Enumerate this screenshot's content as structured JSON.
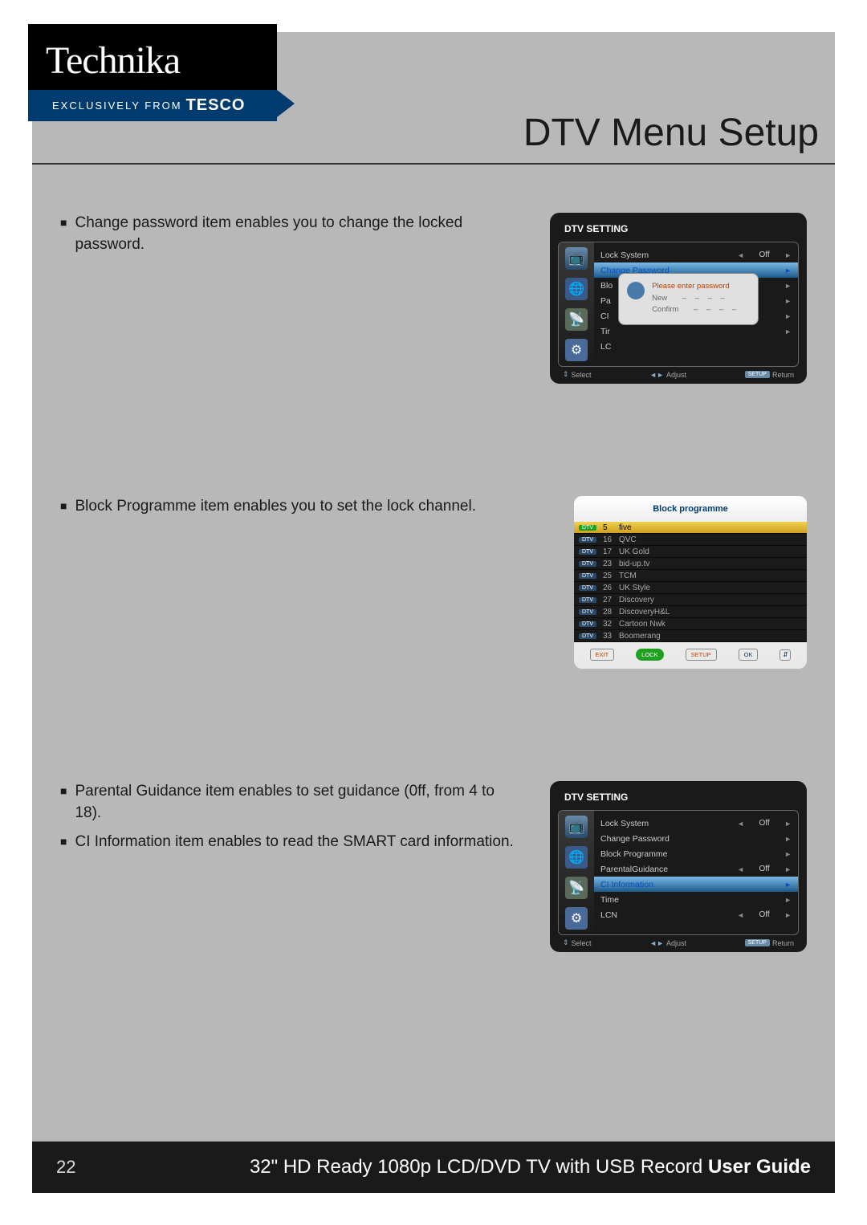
{
  "brand": {
    "name": "Technika",
    "exclusive_prefix": "EXCLUSIVELY FROM",
    "exclusive_brand": "TESCO"
  },
  "page_title": "DTV Menu Setup",
  "sections": [
    {
      "bullets": [
        "Change password item enables you to change the locked password."
      ]
    },
    {
      "bullets": [
        "Block Programme item enables you to set the lock channel."
      ]
    },
    {
      "bullets": [
        "Parental Guidance item enables to set guidance (0ff, from 4 to 18).",
        "CI Information item enables to read the SMART card information."
      ]
    }
  ],
  "osd1": {
    "title": "DTV SETTING",
    "highlighted": "Change Password",
    "rows": [
      {
        "label": "Lock System",
        "value": "Off",
        "arrows": true
      },
      {
        "label": "Change Password",
        "highlighted": true
      },
      {
        "label": "Blo"
      },
      {
        "label": "Pa"
      },
      {
        "label": "CI"
      },
      {
        "label": "Tir"
      },
      {
        "label": "LC"
      }
    ],
    "popup": {
      "prompt": "Please enter password",
      "new_label": "New",
      "confirm_label": "Confirm",
      "dashes": "– – – –"
    },
    "footer": {
      "select": "Select",
      "adjust": "Adjust",
      "return": "Return",
      "setup": "SETUP"
    }
  },
  "osd2": {
    "title": "Block programme",
    "channels": [
      {
        "num": "5",
        "name": "five",
        "selected": true
      },
      {
        "num": "16",
        "name": "QVC"
      },
      {
        "num": "17",
        "name": "UK Gold"
      },
      {
        "num": "23",
        "name": "bid-up.tv"
      },
      {
        "num": "25",
        "name": "TCM"
      },
      {
        "num": "26",
        "name": "UK Style"
      },
      {
        "num": "27",
        "name": "Discovery"
      },
      {
        "num": "28",
        "name": "DiscoveryH&L"
      },
      {
        "num": "32",
        "name": "Cartoon Nwk"
      },
      {
        "num": "33",
        "name": "Boomerang"
      }
    ],
    "dtv_label": "DTV",
    "footer": {
      "exit": "EXIT",
      "lock": "LOCK",
      "setup": "SETUP",
      "ok": "OK"
    }
  },
  "osd3": {
    "title": "DTV SETTING",
    "rows": [
      {
        "label": "Lock System",
        "value": "Off",
        "arrows": true
      },
      {
        "label": "Change Password",
        "arrow_right": true
      },
      {
        "label": "Block Programme",
        "arrow_right": true
      },
      {
        "label": "ParentalGuidance",
        "value": "Off",
        "arrows": true
      },
      {
        "label": "CI Information",
        "highlighted": true,
        "arrow_right": true
      },
      {
        "label": "Time",
        "arrow_right": true
      },
      {
        "label": "LCN",
        "value": "Off",
        "arrows": true
      }
    ],
    "footer": {
      "select": "Select",
      "adjust": "Adjust",
      "return": "Return",
      "setup": "SETUP"
    }
  },
  "footer": {
    "page_number": "22",
    "product_name": "32\" HD Ready 1080p LCD/DVD TV with USB Record",
    "guide_label": "User Guide"
  }
}
